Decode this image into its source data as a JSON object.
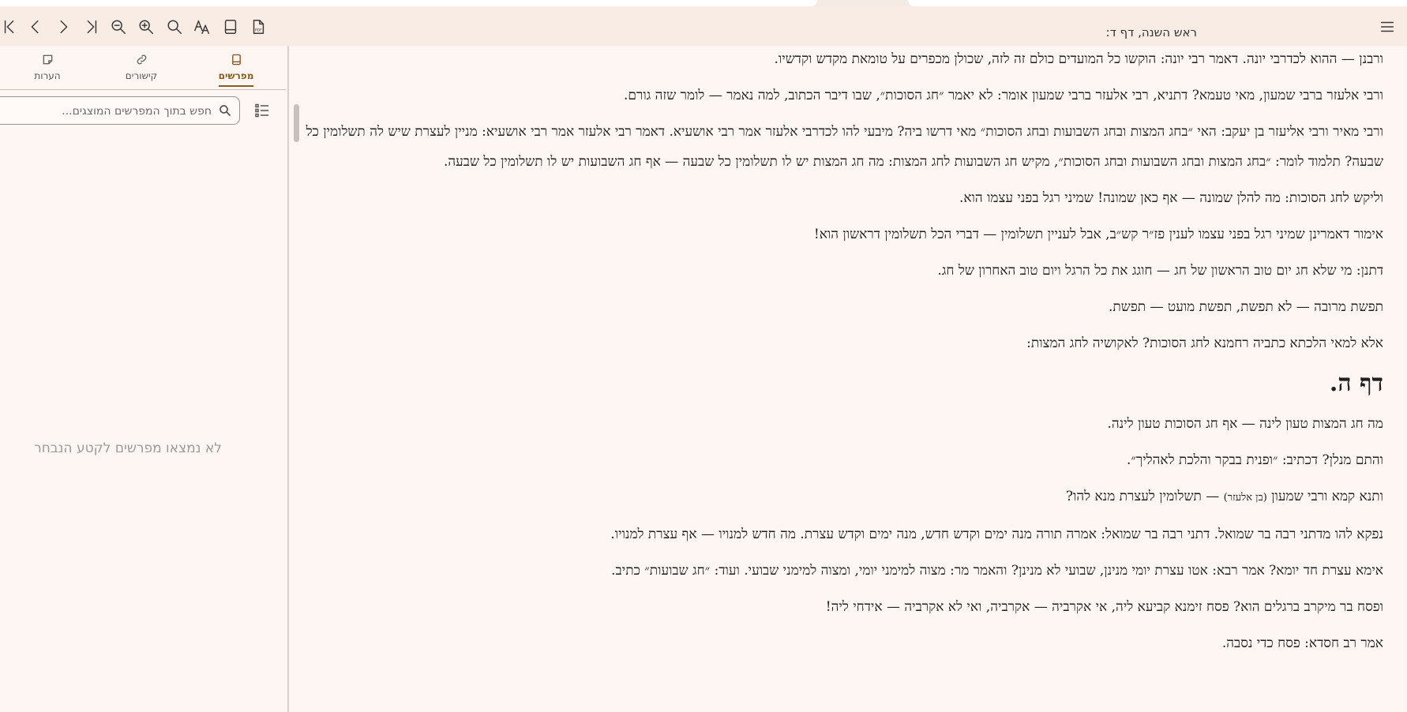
{
  "toolbar": {
    "title": "ראש השנה, דף ד:",
    "buttons": [
      {
        "name": "first-page-icon"
      },
      {
        "name": "previous-page-icon"
      },
      {
        "name": "next-page-icon"
      },
      {
        "name": "last-page-icon"
      },
      {
        "name": "zoom-out-icon"
      },
      {
        "name": "zoom-in-icon"
      },
      {
        "name": "search-icon"
      },
      {
        "name": "font-icon"
      },
      {
        "name": "book-icon"
      },
      {
        "name": "pdf-icon"
      },
      {
        "name": "menu-icon"
      }
    ]
  },
  "sidebar": {
    "tabs": [
      {
        "label": "מפרשים",
        "active": true,
        "icon": "book-icon"
      },
      {
        "label": "קישורים",
        "active": false,
        "icon": "link-icon"
      },
      {
        "label": "הערות",
        "active": false,
        "icon": "note-icon"
      }
    ],
    "search_placeholder": "חפש בתוך המפרשים המוצגים...",
    "empty_message": "לא נמצאו מפרשים לקטע הנבחר"
  },
  "content": {
    "paragraphs_before": [
      "ורבנן — ההוא לכדרבי יונה. דאמר רבי יונה: הוקשו כל המועדים כולם זה לזה, שכולן מכפרים על טומאת מקדש וקדשיו.",
      "ורבי אלעזר ברבי שמעון, מאי טעמא? דתניא, רבי אלעזר ברבי שמעון אומר: לא יאמר ״חג הסוכות״, שבו דיבר הכתוב, למה נאמר — לומר שזה גורם.",
      "ורבי מאיר ורבי אליעזר בן יעקב: האי ״בחג המצות ובחג השבועות ובחג הסוכות״ מאי דרשו ביה? מיבעי להו לכדרבי אלעזר אמר רבי אושעיא. דאמר רבי אלעזר אמר רבי אושעיא: מניין לעצרת שיש לה תשלומין כל שבעה? תלמוד לומר: ״בחג המצות ובחג השבועות ובחג הסוכות״, מקיש חג השבועות לחג המצות: מה חג המצות יש לו תשלומין כל שבעה — אף חג השבועות יש לו תשלומין כל שבעה.",
      "וליקש לחג הסוכות: מה להלן שמונה — אף כאן שמונה! שמיני רגל בפני עצמו הוא.",
      "אימור דאמרינן שמיני רגל בפני עצמו לענין פז״ר קש״ב, אבל לעניין תשלומין — דברי הכל תשלומין דראשון הוא!",
      "דתנן: מי שלא חג יום טוב הראשון של חג — חוגג את כל הרגל ויום טוב האחרון של חג.",
      "תפשת מרובה — לא תפשת, תפשת מועט — תפשת.",
      "אלא למאי הלכתא כתביה רחמנא לחג הסוכות? לאקושיה לחג המצות:"
    ],
    "daf_heading": "דף ה.",
    "paragraphs_after": [
      "מה חג המצות טעון לינה — אף חג הסוכות טעון לינה.",
      "והתם מנלן? דכתיב: ״ופנית בבקר והלכת לאהליך״."
    ],
    "special_para": {
      "pre": "ותנא קמא ורבי שמעון ",
      "small": "(בן אלעזר)",
      "post": " — תשלומין לעצרת מנא להו?"
    },
    "paragraphs_end": [
      "נפקא להו מדתני רבה בר שמואל. דתני רבה בר שמואל: אמרה תורה מנה ימים וקדש חדש, מנה ימים וקדש עצרת. מה חדש למנויו — אף עצרת למנויו.",
      "אימא עצרת חד יומא? אמר רבא: אטו עצרת יומי מנינן, שבועי לא מנינן? והאמר מר: מצוה למימני יומי, ומצוה למימני שבועי. ועוד: ״חג שבועות״ כתיב.",
      "ופסח בר מיקרב ברגלים הוא? פסח זימנא קביעא ליה, אי אקרביה — אקרביה, ואי לא אקרביה — אידחי ליה!",
      "אמר רב חסדא: פסח כדי נסבה."
    ]
  }
}
